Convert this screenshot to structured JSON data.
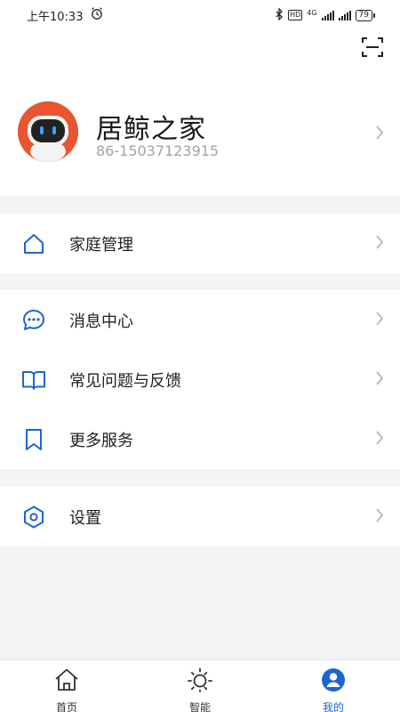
{
  "status_bar": {
    "time": "上午10:33",
    "network": "4G",
    "hd": "HD",
    "battery": "79"
  },
  "profile": {
    "name": "居鲸之家",
    "phone": "86-15037123915"
  },
  "menu": {
    "family": "家庭管理",
    "messages": "消息中心",
    "faq": "常见问题与反馈",
    "more_services": "更多服务",
    "settings": "设置"
  },
  "tabs": [
    {
      "label": "首页",
      "icon": "home-icon"
    },
    {
      "label": "智能",
      "icon": "sun-icon"
    },
    {
      "label": "我的",
      "icon": "user-icon",
      "active": true
    }
  ],
  "colors": {
    "accent": "#1e63d6",
    "avatar_bg": "#e8552f",
    "background": "#f4f4f4"
  }
}
